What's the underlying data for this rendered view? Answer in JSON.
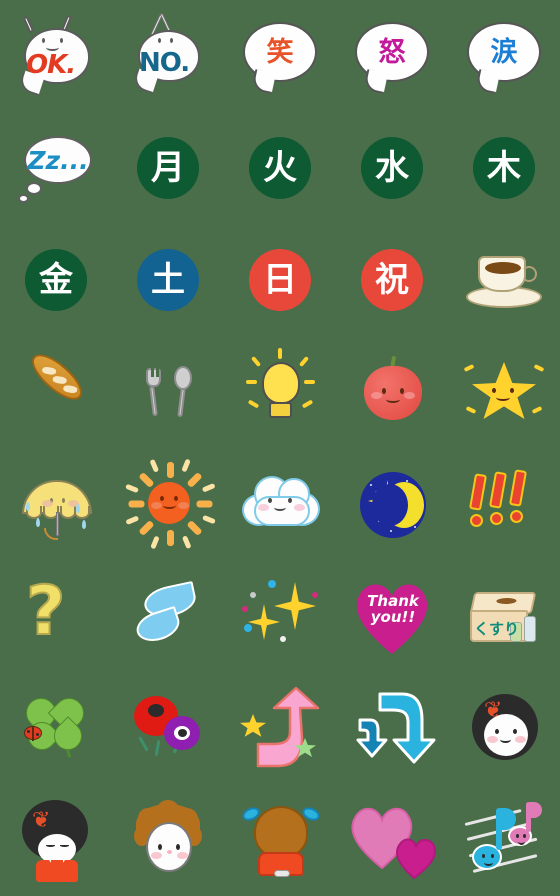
{
  "sticker_set": {
    "background_color": "#4a6d4a",
    "grid": {
      "columns": 5,
      "rows": 8,
      "cell_size_px": 112,
      "total_stickers": 40
    },
    "stickers": [
      {
        "index": 1,
        "name": "ok-blob",
        "label": "OK.",
        "text": "OK.",
        "text_color": "#e23b21",
        "description": "white blob character with arms raised saying OK"
      },
      {
        "index": 2,
        "name": "no-blob",
        "label": "NO.",
        "text": "NO.",
        "text_color": "#15678c",
        "description": "white blob speech bubble with crossed arms saying NO"
      },
      {
        "index": 3,
        "name": "warai-bubble",
        "label": "笑",
        "text": "笑",
        "text_color": "#e8542a",
        "description": "speech bubble with laugh kanji"
      },
      {
        "index": 4,
        "name": "ikari-bubble",
        "label": "怒",
        "text": "怒",
        "text_color": "#c21a9b",
        "description": "speech bubble with anger kanji"
      },
      {
        "index": 5,
        "name": "namida-bubble",
        "label": "涙",
        "text": "涙",
        "text_color": "#1d7fd4",
        "description": "speech bubble with tears kanji"
      },
      {
        "index": 6,
        "name": "sleep-thought-bubble",
        "label": "Zz...",
        "text": "Zz...",
        "text_color": "#1b8fc4",
        "description": "thought bubble with Zz sleeping"
      },
      {
        "index": 7,
        "name": "monday-badge",
        "label": "月",
        "text": "月",
        "text_color": "#ffffff",
        "bg_color": "#0d5a33",
        "description": "Monday kanji in dark green circle"
      },
      {
        "index": 8,
        "name": "tuesday-badge",
        "label": "火",
        "text": "火",
        "text_color": "#ffffff",
        "bg_color": "#0d5a33",
        "description": "Tuesday kanji in dark green circle"
      },
      {
        "index": 9,
        "name": "wednesday-badge",
        "label": "水",
        "text": "水",
        "text_color": "#ffffff",
        "bg_color": "#0d5a33",
        "description": "Wednesday kanji in dark green circle"
      },
      {
        "index": 10,
        "name": "thursday-badge",
        "label": "木",
        "text": "木",
        "text_color": "#ffffff",
        "bg_color": "#0d5a33",
        "description": "Thursday kanji in dark green circle"
      },
      {
        "index": 11,
        "name": "friday-badge",
        "label": "金",
        "text": "金",
        "text_color": "#ffffff",
        "bg_color": "#0d5a33",
        "description": "Friday kanji in dark green circle"
      },
      {
        "index": 12,
        "name": "saturday-badge",
        "label": "土",
        "text": "土",
        "text_color": "#ffffff",
        "bg_color": "#126392",
        "description": "Saturday kanji in blue circle"
      },
      {
        "index": 13,
        "name": "sunday-badge",
        "label": "日",
        "text": "日",
        "text_color": "#ffffff",
        "bg_color": "#e8483a",
        "description": "Sunday kanji in red circle"
      },
      {
        "index": 14,
        "name": "holiday-badge",
        "label": "祝",
        "text": "祝",
        "text_color": "#ffffff",
        "bg_color": "#e8483a",
        "description": "holiday kanji in red circle"
      },
      {
        "index": 15,
        "name": "coffee-cup-icon",
        "label": "コーヒー",
        "text": "",
        "description": "coffee cup on saucer"
      },
      {
        "index": 16,
        "name": "baguette-icon",
        "label": "パン",
        "text": "",
        "description": "golden baguette bread"
      },
      {
        "index": 17,
        "name": "fork-spoon-icon",
        "label": "食事",
        "text": "",
        "description": "fork and spoon cutlery"
      },
      {
        "index": 18,
        "name": "lightbulb-icon",
        "label": "ひらめき",
        "text": "",
        "description": "glowing yellow lightbulb idea"
      },
      {
        "index": 19,
        "name": "apple-face-icon",
        "label": "りんご",
        "text": "",
        "description": "smiling red apple"
      },
      {
        "index": 20,
        "name": "star-face-icon",
        "label": "星",
        "text": "",
        "description": "smiling yellow star"
      },
      {
        "index": 21,
        "name": "umbrella-rain-icon",
        "label": "雨",
        "text": "",
        "description": "yellow umbrella with rain drops"
      },
      {
        "index": 22,
        "name": "sun-face-icon",
        "label": "晴れ",
        "text": "",
        "description": "smiling orange sun"
      },
      {
        "index": 23,
        "name": "cloud-face-icon",
        "label": "くもり",
        "text": "",
        "description": "smiling white cloud"
      },
      {
        "index": 24,
        "name": "moon-night-icon",
        "label": "夜",
        "text": "",
        "description": "crescent moon on navy night sky circle"
      },
      {
        "index": 25,
        "name": "exclamation-marks-icon",
        "label": "！！！",
        "text": "",
        "description": "three red exclamation marks"
      },
      {
        "index": 26,
        "name": "question-mark-icon",
        "label": "？",
        "text": "?",
        "text_color": "#f0e06a",
        "description": "yellow question mark"
      },
      {
        "index": 27,
        "name": "water-drops-icon",
        "label": "水滴",
        "text": "",
        "description": "two blue water drops"
      },
      {
        "index": 28,
        "name": "sparkles-icon",
        "label": "キラキラ",
        "text": "",
        "description": "yellow sparkles with confetti dots"
      },
      {
        "index": 29,
        "name": "thank-you-heart",
        "label": "Thank you!!",
        "text": "Thank you!!",
        "text_color": "#ffffff",
        "bg_color": "#c91f8e",
        "description": "magenta heart with Thank you message"
      },
      {
        "index": 30,
        "name": "medicine-box-icon",
        "label": "くすり",
        "text": "くすり",
        "text_color": "#0f8d7a",
        "description": "medicine box with bottles"
      },
      {
        "index": 31,
        "name": "clover-ladybug-icon",
        "label": "四つ葉",
        "text": "",
        "description": "four leaf clover with ladybug"
      },
      {
        "index": 32,
        "name": "flowers-icon",
        "label": "花",
        "text": "",
        "description": "red and purple anemone flowers"
      },
      {
        "index": 33,
        "name": "arrow-up-pink-icon",
        "label": "上矢印",
        "text": "",
        "description": "pink curved up arrow with stars"
      },
      {
        "index": 34,
        "name": "arrow-down-blue-icon",
        "label": "下矢印",
        "text": "",
        "description": "blue curved down arrow"
      },
      {
        "index": 35,
        "name": "girl-bob-hair-face",
        "label": "女の子",
        "text": "",
        "description": "girl face with black bob hair and red bow"
      },
      {
        "index": 36,
        "name": "girl-bowing-icon",
        "label": "おじぎ",
        "text": "",
        "description": "girl with red bow bowing in orange dress"
      },
      {
        "index": 37,
        "name": "curly-hair-face",
        "label": "男の子",
        "text": "",
        "description": "face with curly brown hair"
      },
      {
        "index": 38,
        "name": "girl-back-view-icon",
        "label": "後ろ姿",
        "text": "",
        "description": "back view of girl with blue ribbons"
      },
      {
        "index": 39,
        "name": "double-hearts-icon",
        "label": "ハート",
        "text": "",
        "description": "pink and magenta hearts"
      },
      {
        "index": 40,
        "name": "music-notes-icon",
        "label": "音符",
        "text": "",
        "description": "blue and pink smiling music notes on staff"
      }
    ]
  }
}
